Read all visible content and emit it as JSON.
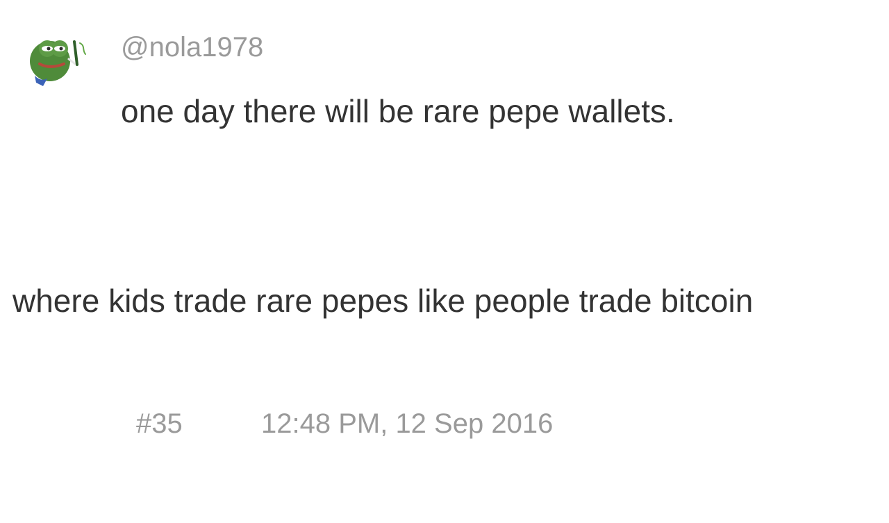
{
  "post": {
    "username": "@nola1978",
    "message_line_1": "one day there will be rare pepe wallets.",
    "message_line_2": "where kids trade rare pepes like people trade bitcoin",
    "post_number": "#35",
    "timestamp": "12:48 PM, 12 Sep 2016",
    "avatar_icon": "frog-avatar-icon"
  },
  "colors": {
    "background": "#ffffff",
    "body_text": "#333333",
    "meta_text": "#9a9a9a",
    "avatar_green": "#4f8b3a",
    "avatar_dark_green": "#2f5f2a",
    "avatar_red": "#b54a3b",
    "avatar_blue": "#3b63b8"
  }
}
